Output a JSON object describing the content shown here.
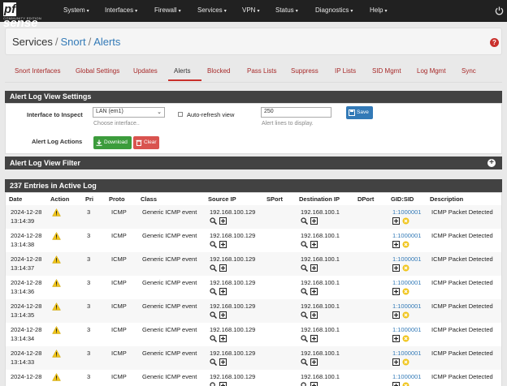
{
  "brand": {
    "logo_text": "sense",
    "logo_prefix": "pf",
    "logo_sub": "COMMUNITY EDITION"
  },
  "nav": [
    {
      "label": "System"
    },
    {
      "label": "Interfaces"
    },
    {
      "label": "Firewall"
    },
    {
      "label": "Services"
    },
    {
      "label": "VPN"
    },
    {
      "label": "Status"
    },
    {
      "label": "Diagnostics"
    },
    {
      "label": "Help"
    }
  ],
  "breadcrumb": {
    "part1": "Services",
    "part2": "Snort",
    "part3": "Alerts",
    "sep": "/"
  },
  "tabs": [
    {
      "label": "Snort Interfaces"
    },
    {
      "label": "Global Settings"
    },
    {
      "label": "Updates"
    },
    {
      "label": "Alerts"
    },
    {
      "label": "Blocked"
    },
    {
      "label": "Pass Lists"
    },
    {
      "label": "Suppress"
    },
    {
      "label": "IP Lists"
    },
    {
      "label": "SID Mgmt"
    },
    {
      "label": "Log Mgmt"
    },
    {
      "label": "Sync"
    }
  ],
  "settings": {
    "title": "Alert Log View Settings",
    "interface_label": "Interface to Inspect",
    "interface_value": "LAN (em1)",
    "interface_help": "Choose interface..",
    "autorefresh_label": "Auto-refresh view",
    "lines_value": "250",
    "lines_help": "Alert lines to display.",
    "save_label": "Save",
    "actions_label": "Alert Log Actions",
    "download_label": "Download",
    "clear_label": "Clear"
  },
  "filter": {
    "title": "Alert Log View Filter"
  },
  "log": {
    "title": "237 Entries in Active Log",
    "headers": [
      "Date",
      "Action",
      "Pri",
      "Proto",
      "Class",
      "Source IP",
      "SPort",
      "Destination IP",
      "DPort",
      "GID:SID",
      "Description"
    ],
    "rows": [
      {
        "date": "2024-12-28",
        "time": "13:14:39",
        "pri": "3",
        "proto": "ICMP",
        "class": "Generic ICMP event",
        "src": "192.168.100.129",
        "dst": "192.168.100.1",
        "sid": "1:1000001",
        "desc": "ICMP Packet Detected"
      },
      {
        "date": "2024-12-28",
        "time": "13:14:38",
        "pri": "3",
        "proto": "ICMP",
        "class": "Generic ICMP event",
        "src": "192.168.100.129",
        "dst": "192.168.100.1",
        "sid": "1:1000001",
        "desc": "ICMP Packet Detected"
      },
      {
        "date": "2024-12-28",
        "time": "13:14:37",
        "pri": "3",
        "proto": "ICMP",
        "class": "Generic ICMP event",
        "src": "192.168.100.129",
        "dst": "192.168.100.1",
        "sid": "1:1000001",
        "desc": "ICMP Packet Detected"
      },
      {
        "date": "2024-12-28",
        "time": "13:14:36",
        "pri": "3",
        "proto": "ICMP",
        "class": "Generic ICMP event",
        "src": "192.168.100.129",
        "dst": "192.168.100.1",
        "sid": "1:1000001",
        "desc": "ICMP Packet Detected"
      },
      {
        "date": "2024-12-28",
        "time": "13:14:35",
        "pri": "3",
        "proto": "ICMP",
        "class": "Generic ICMP event",
        "src": "192.168.100.129",
        "dst": "192.168.100.1",
        "sid": "1:1000001",
        "desc": "ICMP Packet Detected"
      },
      {
        "date": "2024-12-28",
        "time": "13:14:34",
        "pri": "3",
        "proto": "ICMP",
        "class": "Generic ICMP event",
        "src": "192.168.100.129",
        "dst": "192.168.100.1",
        "sid": "1:1000001",
        "desc": "ICMP Packet Detected"
      },
      {
        "date": "2024-12-28",
        "time": "13:14:33",
        "pri": "3",
        "proto": "ICMP",
        "class": "Generic ICMP event",
        "src": "192.168.100.129",
        "dst": "192.168.100.1",
        "sid": "1:1000001",
        "desc": "ICMP Packet Detected"
      },
      {
        "date": "2024-12-28",
        "time": "",
        "pri": "3",
        "proto": "ICMP",
        "class": "Generic ICMP event",
        "src": "192.168.100.129",
        "dst": "192.168.100.1",
        "sid": "1:1000001",
        "desc": "ICMP Packet Detected"
      }
    ]
  },
  "colors": {
    "navbar": "#212121",
    "panel_head": "#424242",
    "link": "#337ab7",
    "tab": "#a72929",
    "warning": "#f0c419"
  }
}
